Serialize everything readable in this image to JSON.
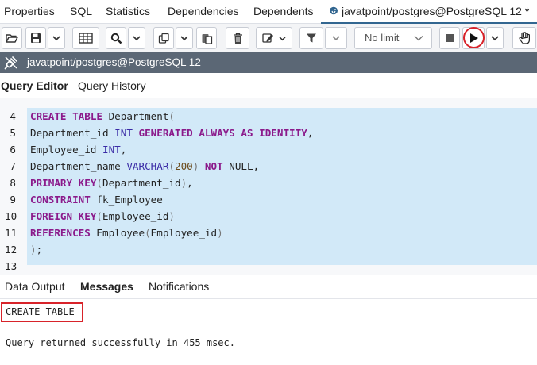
{
  "top_tabs": [
    {
      "label": "Properties"
    },
    {
      "label": "SQL"
    },
    {
      "label": "Statistics"
    },
    {
      "label": "Dependencies"
    },
    {
      "label": "Dependents"
    },
    {
      "label": "javatpoint/postgres@PostgreSQL 12 *",
      "icon": "postgres-elephant-icon",
      "active": true
    }
  ],
  "toolbar": {
    "limit_label": "No limit",
    "icons": [
      "folder-open-icon",
      "save-icon",
      "chevron-down-icon",
      "grid-icon",
      "search-icon",
      "copy-icon",
      "paste-icon",
      "trash-icon",
      "edit-icon",
      "filter-icon",
      "stop-icon",
      "play-icon",
      "hand-icon"
    ]
  },
  "connection": {
    "label": "javatpoint/postgres@PostgreSQL 12"
  },
  "editor_tabs": [
    {
      "label": "Query Editor",
      "active": true
    },
    {
      "label": "Query History"
    }
  ],
  "code": {
    "line_numbers": [
      "4",
      "5",
      "6",
      "7",
      "8",
      "9",
      "10",
      "11",
      "12",
      "13"
    ],
    "lines": [
      [
        {
          "t": "CREATE TABLE",
          "c": "kw"
        },
        {
          "t": " Department",
          "c": ""
        },
        {
          "t": "(",
          "c": "pn"
        }
      ],
      [
        {
          "t": "Department_id ",
          "c": ""
        },
        {
          "t": "INT",
          "c": "ty"
        },
        {
          "t": " ",
          "c": ""
        },
        {
          "t": "GENERATED ALWAYS AS IDENTITY",
          "c": "kw"
        },
        {
          "t": ",",
          "c": ""
        }
      ],
      [
        {
          "t": "Employee_id ",
          "c": ""
        },
        {
          "t": "INT",
          "c": "ty"
        },
        {
          "t": ",",
          "c": ""
        }
      ],
      [
        {
          "t": "Department_name ",
          "c": ""
        },
        {
          "t": "VARCHAR",
          "c": "ty"
        },
        {
          "t": "(",
          "c": "pn"
        },
        {
          "t": "200",
          "c": "num"
        },
        {
          "t": ") ",
          "c": "pn"
        },
        {
          "t": "NOT",
          "c": "kw"
        },
        {
          "t": " NULL,",
          "c": ""
        }
      ],
      [
        {
          "t": "PRIMARY KEY",
          "c": "kw"
        },
        {
          "t": "(",
          "c": "pn"
        },
        {
          "t": "Department_id",
          "c": ""
        },
        {
          "t": ")",
          "c": "pn"
        },
        {
          "t": ",",
          "c": ""
        }
      ],
      [
        {
          "t": "CONSTRAINT",
          "c": "kw"
        },
        {
          "t": " fk_Employee",
          "c": ""
        }
      ],
      [
        {
          "t": "FOREIGN KEY",
          "c": "kw"
        },
        {
          "t": "(",
          "c": "pn"
        },
        {
          "t": "Employee_id",
          "c": ""
        },
        {
          "t": ")",
          "c": "pn"
        }
      ],
      [
        {
          "t": "REFERENCES",
          "c": "kw"
        },
        {
          "t": " Employee",
          "c": ""
        },
        {
          "t": "(",
          "c": "pn"
        },
        {
          "t": "Employee_id",
          "c": ""
        },
        {
          "t": ")",
          "c": "pn"
        }
      ],
      [
        {
          "t": ")",
          "c": "pn"
        },
        {
          "t": ";",
          "c": ""
        }
      ],
      []
    ]
  },
  "result_tabs": [
    {
      "label": "Data Output"
    },
    {
      "label": "Messages",
      "active": true
    },
    {
      "label": "Notifications"
    }
  ],
  "messages": {
    "line1": "CREATE TABLE",
    "line2": "Query returned successfully in 455 msec."
  },
  "colors": {
    "accent": "#326690",
    "highlight": "#d8232a",
    "selection": "#d2e9f8",
    "connection_bar": "#5b6775"
  }
}
